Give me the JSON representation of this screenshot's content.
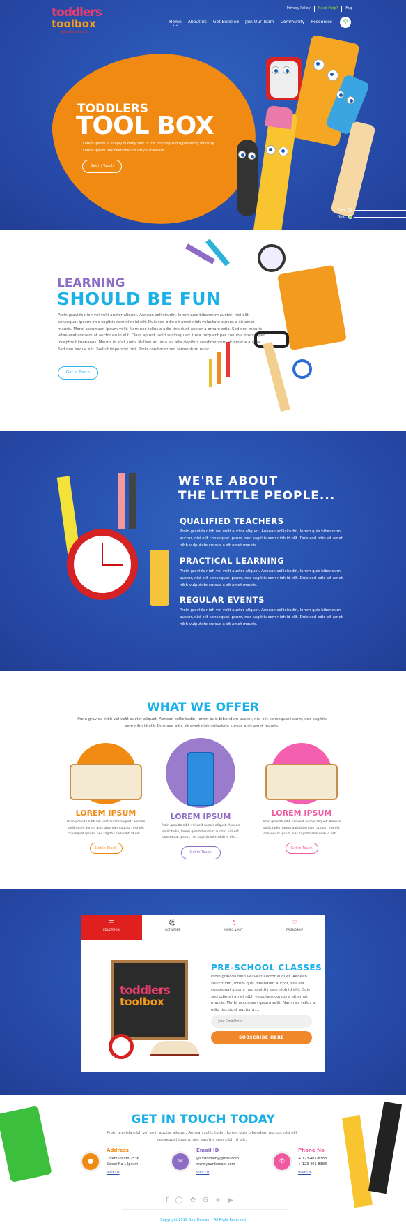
{
  "brand": {
    "logo_line1": "toddlers",
    "logo_line2": "toolbox",
    "logo_line3": "Learning Center"
  },
  "header": {
    "top_links": [
      "Privacy Policy",
      "Need Help?",
      "Faq"
    ],
    "nav": [
      "Home",
      "About Us",
      "Get Enrolled",
      "Join Our Team",
      "Community",
      "Resources"
    ],
    "search_icon": "search-icon"
  },
  "hero": {
    "title_small": "TODDLERS",
    "title_large": "TOOL BOX",
    "text": "Lorem Ipsum is simply dummy text of the printing and typesetting industry Lorem Ipsum has been the industry's standard....",
    "button": "Get in Touch",
    "prev": "Prev",
    "next": "Next",
    "accent": "#f08a12"
  },
  "learning": {
    "title1": "LEARNING",
    "title2": "SHOULD BE FUN",
    "text": "Proin gravida nibh vel velit auctor aliquet. Aenean sollicitudin, lorem quis bibendum auctor, nisi elit consequat ipsum, nec sagittis sem nibh id elit. Duis sed odio sit amet nibh vulputate cursus a sit amet mauris. Morbi accumsan ipsum velit. Nam nec tellus a odio tincidunt auctor a ornare odio. Sed non  mauris vitae erat consequat auctor eu in elit. Class aptent taciti sociosqu ad litora torquent per conubia nostra, per inceptos himenaeos. Mauris in erat justo. Nullam ac urna eu felis dapibus condimentum sit amet a augue. Sed non neque elit. Sed ut imperdiet nisi. Proin condimentum fermentum nunc......",
    "button": "Get in Touch"
  },
  "about": {
    "title1": "WE'RE ABOUT",
    "title2": "THE LITTLE PEOPLE...",
    "items": [
      {
        "title": "QUALIFIED TEACHERS",
        "text": "Proin gravida nibh vel velit auctor aliquet. Aenean sollicitudin, lorem quis bibendum auctor, nisi elit consequat ipsum, nec sagittis sem nibh id elit. Duis sed odio sit amet nibh vulputate cursus a sit amet mauris."
      },
      {
        "title": "PRACTICAL LEARNING",
        "text": "Proin gravida nibh vel velit auctor aliquet. Aenean sollicitudin, lorem quis bibendum auctor, nisi elit consequat ipsum, nec sagittis sem nibh id elit. Duis sed odio sit amet nibh vulputate cursus a sit amet mauris."
      },
      {
        "title": "REGULAR EVENTS",
        "text": "Proin gravida nibh vel velit auctor aliquet. Aenean sollicitudin, lorem quis bibendum auctor, nisi elit consequat ipsum, nec sagittis sem nibh id elit. Duis sed odio sit amet nibh vulputate cursus a sit amet mauris."
      }
    ]
  },
  "offer": {
    "title": "WHAT WE OFFER",
    "text": "Proin gravida nibh vel velit auctor aliquet. Aenean sollicitudin, lorem quis bibendum auctor, nisi elit consequat ipsum, nec sagittis sem nibh id elit. Duis sed odio sit amet nibh vulputate cursus a sit amet mauris.",
    "cards": [
      {
        "title": "LOREM IPSUM",
        "text": "Proin gravida nibh vel velit auctor aliquet. Aenean sollicitudin, lorem quis bibendum auctor, nisi elit consequat ipsum, nec sagittis sem nibh id elit....",
        "button": "Get in Touch",
        "color": "#f08a12"
      },
      {
        "title": "LOREM IPSUM",
        "text": "Proin gravida nibh vel velit auctor aliquet. Aenean sollicitudin, lorem quis bibendum auctor, nisi elit consequat ipsum, nec sagittis sem nibh id elit....",
        "button": "Get in Touch",
        "color": "#8c6cc4"
      },
      {
        "title": "LOREM IPSUM",
        "text": "Proin gravida nibh vel velit auctor aliquet. Aenean sollicitudin, lorem quis bibendum auctor, nisi elit consequat ipsum, nec sagittis sem nibh id elit....",
        "button": "Get in Touch",
        "color": "#f0599f"
      }
    ]
  },
  "classes": {
    "tabs": [
      "EDUCATION",
      "ACTIVITIES",
      "MUSIC & ART",
      "FRIENDSHIP"
    ],
    "title": "PRE-SCHOOL CLASSES",
    "text": "Proin gravida nibh vel velit auctor aliquet. Aenean sollicitudin, lorem quis bibendum auctor, nisi elit consequat ipsum, nec sagittis sem nibh id elit. Duis sed odio sit amet nibh vulputate cursus a sit amet mauris. Morbi accumsan ipsum velit. Nam nec tellus a odio tincidunt auctor a.....",
    "email_placeholder": "your Email here",
    "subscribe": "SUBSCRIBE HERE"
  },
  "contact": {
    "title": "GET IN TOUCH TODAY",
    "text": "Proin gravida nibh vel velit auctor aliquet. Aenean sollicitudin, lorem quis bibendum auctor, nisi elit consequat ipsum, nec sagittis sem nibh id elit.",
    "address": {
      "label": "Address",
      "line1": "Lorem Ipsum 2536",
      "line2": "Street No 1 Ipsum",
      "link": "Visit Us"
    },
    "email": {
      "label": "Email ID",
      "line1": "yourdomain@gmail.com",
      "line2": "www.yourdomain.com",
      "link": "Visit Us"
    },
    "phone": {
      "label": "Phone No",
      "line1": "+ 123-401-8383",
      "line2": "+ 123-401-8383",
      "link": "Visit Us"
    },
    "social": [
      "facebook",
      "instagram",
      "twitter",
      "google-plus",
      "youtube"
    ],
    "copyright": "Copyright 2019 Your Domain . All Right Reserved"
  }
}
